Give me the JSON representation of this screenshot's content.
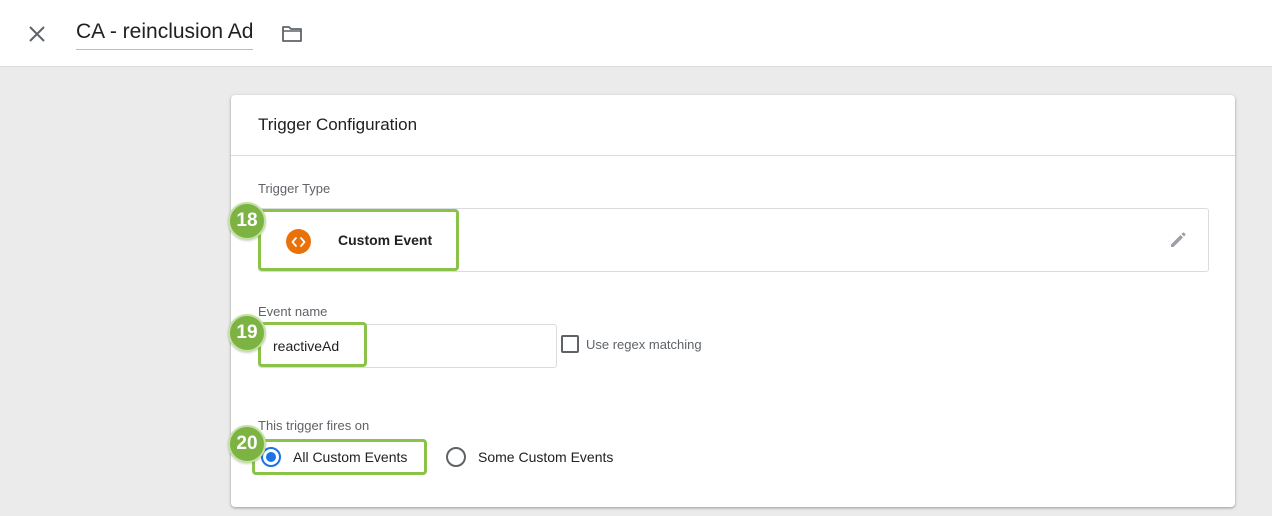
{
  "header": {
    "title": "CA - reinclusion Ad",
    "close_icon": "close-icon",
    "folder_icon": "folder-icon"
  },
  "card": {
    "title": "Trigger Configuration",
    "trigger_type": {
      "label": "Trigger Type",
      "value": "Custom Event",
      "icon": "custom-event-code-icon",
      "icon_color": "#e8710a",
      "edit_icon": "pencil-icon"
    },
    "event_name": {
      "label": "Event name",
      "value": "reactiveAd",
      "regex_label": "Use regex matching",
      "regex_checked": false
    },
    "fires_on": {
      "label": "This trigger fires on",
      "options": [
        {
          "label": "All Custom Events",
          "selected": true
        },
        {
          "label": "Some Custom Events",
          "selected": false
        }
      ]
    }
  },
  "annotations": {
    "color": "#8bc34a",
    "badges": [
      "18",
      "19",
      "20"
    ]
  }
}
